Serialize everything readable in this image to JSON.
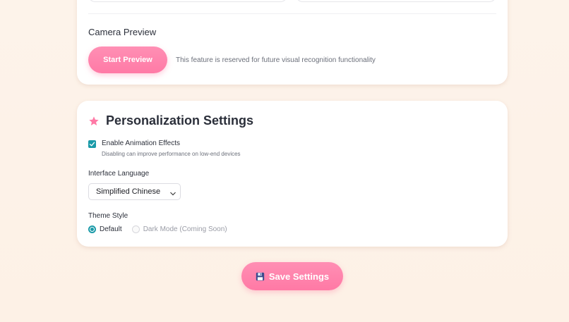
{
  "camera": {
    "section_label": "Camera Preview",
    "start_button": "Start Preview",
    "note": "This feature is reserved for future visual recognition functionality"
  },
  "personalization": {
    "title": "Personalization Settings",
    "title_icon": "star-icon",
    "animation": {
      "label": "Enable Animation Effects",
      "hint": "Disabling can improve performance on low-end devices",
      "checked": true
    },
    "language": {
      "label": "Interface Language",
      "selected": "Simplified Chinese"
    },
    "theme": {
      "label": "Theme Style",
      "options": [
        {
          "label": "Default",
          "selected": true,
          "disabled": false
        },
        {
          "label": "Dark Mode (Coming Soon)",
          "selected": false,
          "disabled": true
        }
      ]
    }
  },
  "save_button": {
    "label": "Save Settings",
    "icon": "floppy-disk-icon"
  },
  "colors": {
    "accent_pink": "#ff7aa6",
    "accent_teal": "#1a9aa8",
    "background": "#fdf3ea"
  }
}
